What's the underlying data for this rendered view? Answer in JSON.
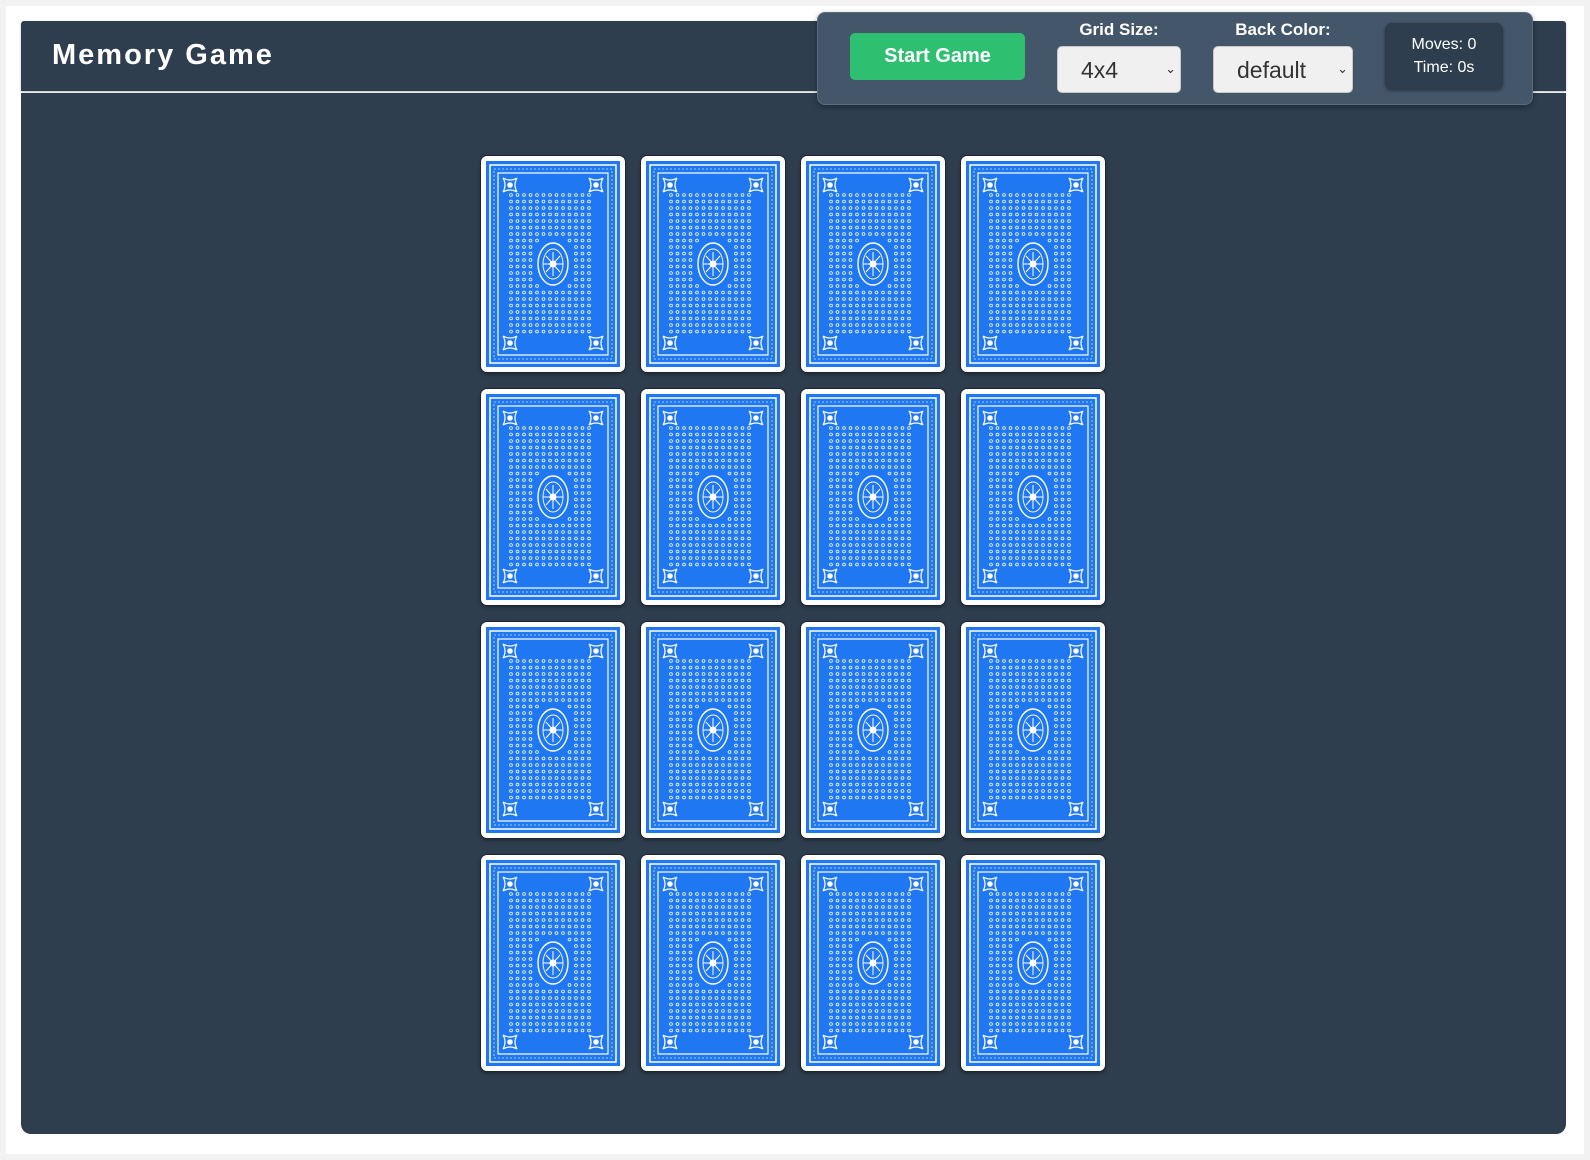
{
  "app": {
    "title": "Memory Game"
  },
  "controls": {
    "start_label": "Start Game",
    "grid_size_label": "Grid Size:",
    "grid_size_value": "4x4",
    "back_color_label": "Back Color:",
    "back_color_value": "default"
  },
  "stats": {
    "moves": "Moves: 0",
    "time": "Time: 0s"
  },
  "board": {
    "rows": 4,
    "columns": 4,
    "card_back_icon": "card-back-pattern",
    "card_back_color": "#1f78f2"
  },
  "colors": {
    "header_bg": "#2e3e4f",
    "board_bg": "#2e3e4f",
    "controls_bg": "#44566a",
    "start_button": "#2fbf71"
  }
}
